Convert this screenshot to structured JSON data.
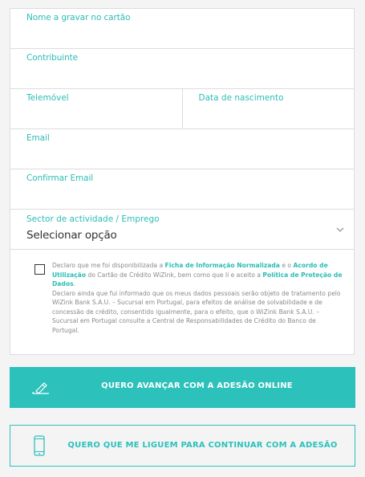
{
  "form": {
    "fields": {
      "card_name": {
        "label": "Nome a gravar no cartão",
        "value": ""
      },
      "contribuinte": {
        "label": "Contribuinte",
        "value": ""
      },
      "telemovel": {
        "label": "Telemóvel",
        "value": ""
      },
      "birthdate": {
        "label": "Data de nascimento",
        "value": ""
      },
      "email": {
        "label": "Email",
        "value": ""
      },
      "confirm_email": {
        "label": "Confirmar Email",
        "value": ""
      }
    },
    "sector": {
      "label": "Sector de actividade / Emprego",
      "selected": "Selecionar opção"
    },
    "consent": {
      "checked": false,
      "t1": "Declaro que me foi disponibilizada a ",
      "link1": "Ficha de Informação Normalizada",
      "t2": " e o ",
      "link2": "Acordo de Utilização",
      "t3": " do Cartão de Crédito WiZink, bem como que li e aceito a ",
      "link3": "Política de Proteção de Dados",
      "t4": ".",
      "paragraph2": "Declaro ainda que fui informado que os meus dados pessoais serão objeto de tratamento pelo WiZink Bank S.A.U. – Sucursal em Portugal, para efeitos de análise de solvabilidade e de concessão de crédito, consentido igualmente, para o efeito, que o WiZink Bank S.A.U. – Sucursal em Portugal consulte a Central de Responsabilidades de Crédito do Banco de Portugal."
    }
  },
  "buttons": {
    "online": {
      "label": "QUERO AVANÇAR COM A ADESÃO ONLINE",
      "icon": "pen-signature-icon"
    },
    "callback": {
      "label": "QUERO QUE ME LIGUEM PARA CONTINUAR COM A ADESÃO",
      "icon": "smartphone-icon"
    }
  },
  "colors": {
    "accent": "#2cc1bb",
    "label_teal": "#2bbdb5",
    "border": "#dcdcdc",
    "background": "#f4f4f4"
  }
}
